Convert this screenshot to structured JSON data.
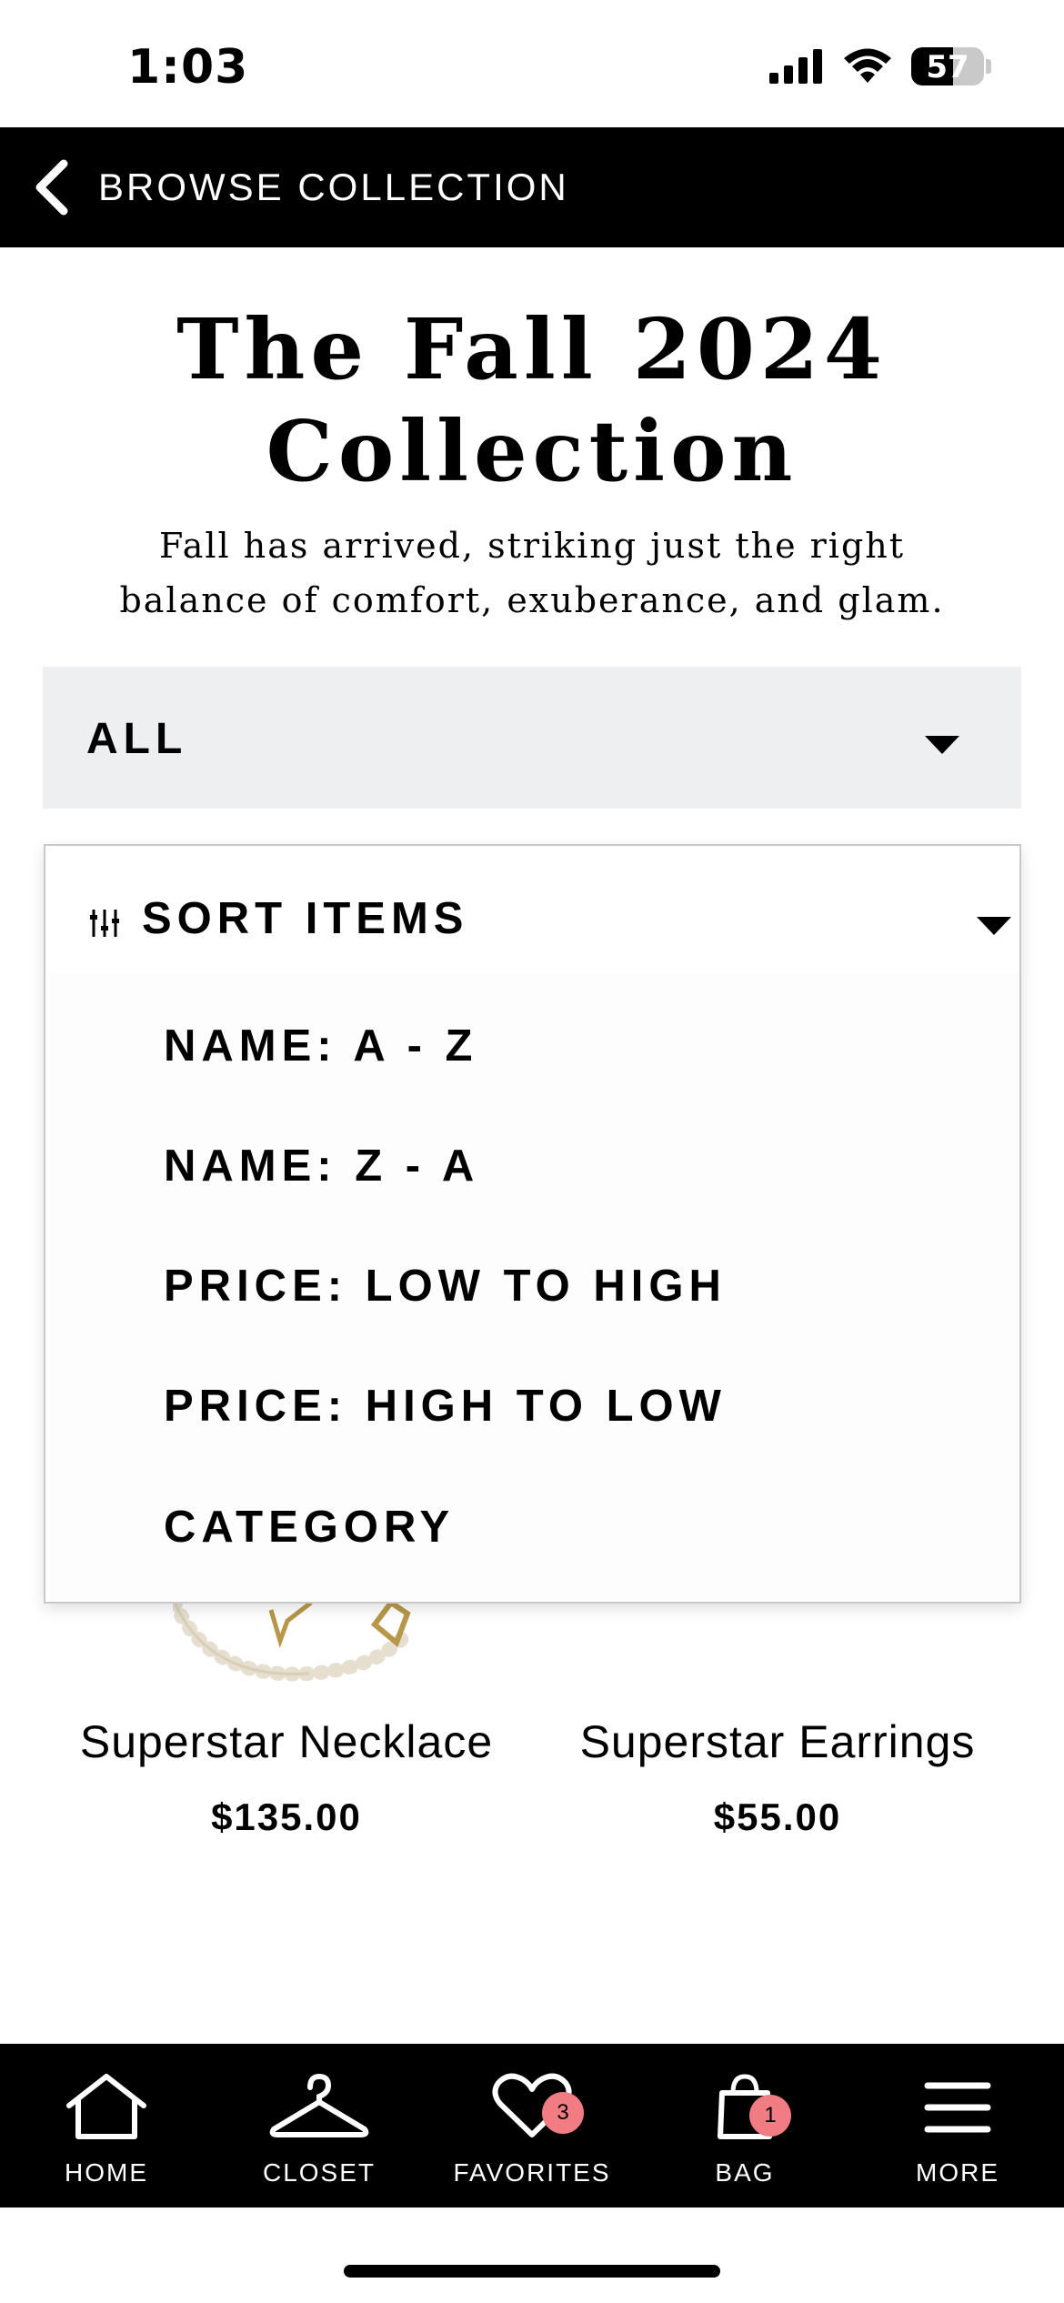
{
  "status_bar": {
    "time": "1:03",
    "battery": "57",
    "battery_level": 0.57
  },
  "header": {
    "back_label": "BROWSE COLLECTION"
  },
  "page": {
    "title_line1": "The Fall 2024",
    "title_line2": "Collection",
    "subtitle_line1": "Fall has arrived, striking just the right",
    "subtitle_line2": "balance of comfort, exuberance, and glam."
  },
  "filter": {
    "selected": "ALL"
  },
  "sort": {
    "label": "SORT ITEMS",
    "options": [
      "NAME: A - Z",
      "NAME: Z - A",
      "PRICE: LOW TO HIGH",
      "PRICE: HIGH TO LOW",
      "CATEGORY"
    ]
  },
  "products": [
    {
      "name": "Superstar Necklace",
      "price": "$135.00"
    },
    {
      "name": "Superstar Earrings",
      "price": "$55.00"
    }
  ],
  "bottom_nav": {
    "items": [
      {
        "label": "HOME",
        "icon": "home-icon"
      },
      {
        "label": "CLOSET",
        "icon": "hanger-icon"
      },
      {
        "label": "FAVORITES",
        "icon": "heart-icon",
        "badge": "3"
      },
      {
        "label": "BAG",
        "icon": "bag-icon",
        "badge": "1"
      },
      {
        "label": "MORE",
        "icon": "menu-icon"
      }
    ]
  },
  "colors": {
    "header_bg": "#000000",
    "filter_bg": "#eeeff0",
    "badge": "#f27c84"
  }
}
